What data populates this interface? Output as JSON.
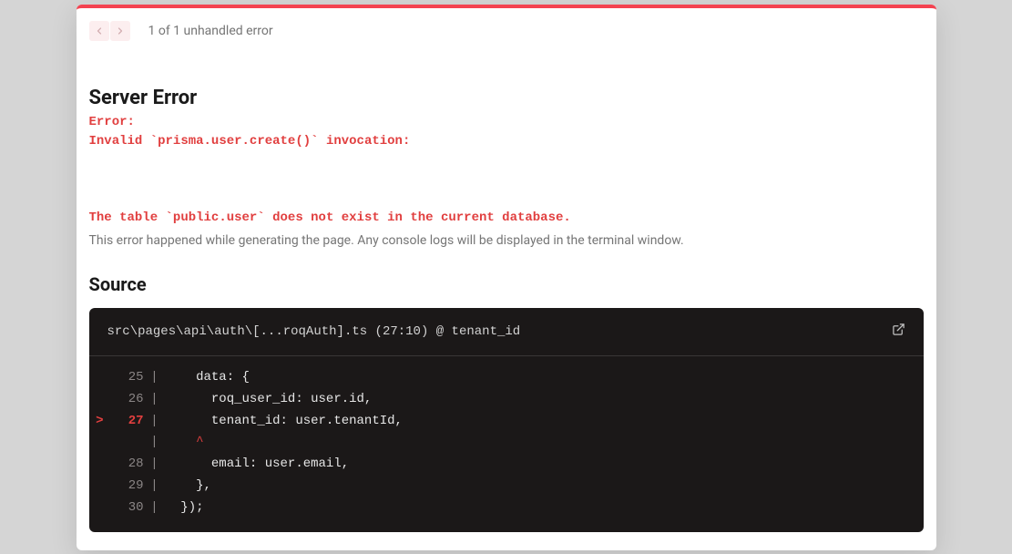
{
  "header": {
    "error_count": "1 of 1 unhandled error"
  },
  "title": "Server Error",
  "error_message": "Error: \nInvalid `prisma.user.create()` invocation:\n\n\n\nThe table `public.user` does not exist in the current database.",
  "error_description": "This error happened while generating the page. Any console logs will be displayed in the terminal window.",
  "source": {
    "heading": "Source",
    "location": "src\\pages\\api\\auth\\[...roqAuth].ts (27:10) @ tenant_id",
    "lines": [
      {
        "prefix": "",
        "num": "25",
        "text": "    data: {"
      },
      {
        "prefix": "",
        "num": "26",
        "text": "      roq_user_id: user.id,"
      },
      {
        "prefix": ">",
        "num": "27",
        "text": "      tenant_id: user.tenantId,"
      },
      {
        "prefix": "",
        "num": "",
        "text": "    ^",
        "caret": true
      },
      {
        "prefix": "",
        "num": "28",
        "text": "      email: user.email,"
      },
      {
        "prefix": "",
        "num": "29",
        "text": "    },"
      },
      {
        "prefix": "",
        "num": "30",
        "text": "  });"
      }
    ]
  }
}
